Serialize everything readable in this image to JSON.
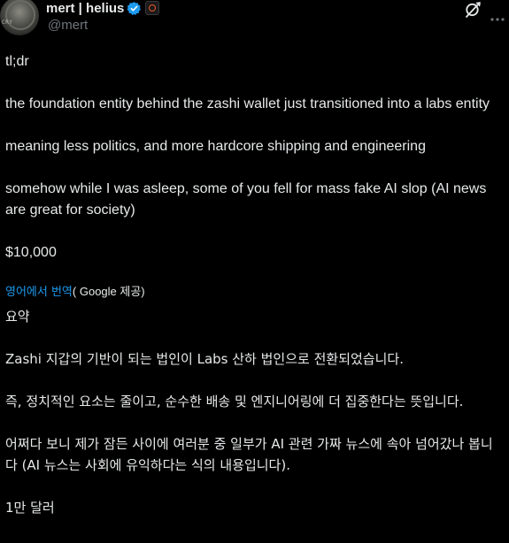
{
  "author": {
    "display_name": "mert | helius",
    "handle": "@mert",
    "avatar_caption": "CRY"
  },
  "icons": {
    "verified": "verified-badge-icon",
    "affiliate": "affiliate-badge-icon",
    "grok": "grok-icon",
    "more": "more-icon"
  },
  "colors": {
    "background": "#000000",
    "text": "#e7e9ea",
    "secondary_text": "#71767b",
    "link": "#1d9bf0",
    "verified": "#1d9bf0"
  },
  "post": {
    "lines": [
      "tl;dr",
      "the foundation entity behind the zashi wallet just transitioned into a labs entity",
      "meaning less politics, and more hardcore shipping and engineering",
      "somehow while I was asleep, some of you fell for mass fake AI slop (AI news are great for society)",
      "$10,000"
    ]
  },
  "translation": {
    "link_text": "영어에서 번역",
    "provider_text": "( Google 제공)",
    "lines": [
      "요약",
      "Zashi 지갑의 기반이 되는 법인이 Labs 산하 법인으로 전환되었습니다.",
      "즉, 정치적인 요소는 줄이고, 순수한 배송 및 엔지니어링에 더 집중한다는 뜻입니다.",
      "어쩌다 보니 제가 잠든 사이에 여러분 중 일부가 AI 관련 가짜 뉴스에 속아 넘어갔나 봅니다 (AI 뉴스는 사회에 유익하다는 식의 내용입니다).",
      "1만 달러"
    ]
  }
}
